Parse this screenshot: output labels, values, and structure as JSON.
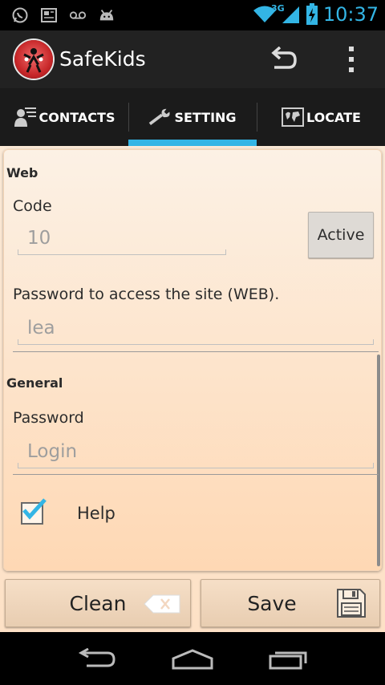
{
  "status_bar": {
    "time": "10:37",
    "network": "3G",
    "icons": [
      "whatsapp-icon",
      "news-icon",
      "voicemail-icon",
      "android-icon",
      "wifi-icon",
      "signal-icon",
      "battery-charging-icon"
    ]
  },
  "action_bar": {
    "title": "SafeKids",
    "actions": [
      "undo-icon",
      "overflow-menu-icon"
    ]
  },
  "tabs": [
    {
      "label": "CONTACTS",
      "icon": "contacts-icon",
      "active": false
    },
    {
      "label": "SETTING",
      "icon": "wrench-icon",
      "active": true
    },
    {
      "label": "LOCATE",
      "icon": "map-icon",
      "active": false
    }
  ],
  "web": {
    "section_title": "Web",
    "code_label": "Code",
    "code_placeholder": "10",
    "active_label": "Active",
    "password_label": "Password to access the site (WEB).",
    "password_placeholder": "lea"
  },
  "general": {
    "section_title": "General",
    "password_label": "Password",
    "password_placeholder": "Login",
    "help_label": "Help",
    "help_checked": true
  },
  "buttons": {
    "clean_label": "Clean",
    "save_label": "Save"
  },
  "colors": {
    "accent": "#33b5e5",
    "action_bar": "#222222",
    "tab_bar": "#1b1b1b",
    "content_bg": "#fde1c6"
  },
  "nav_bar": [
    "back-icon",
    "home-icon",
    "recent-apps-icon"
  ]
}
